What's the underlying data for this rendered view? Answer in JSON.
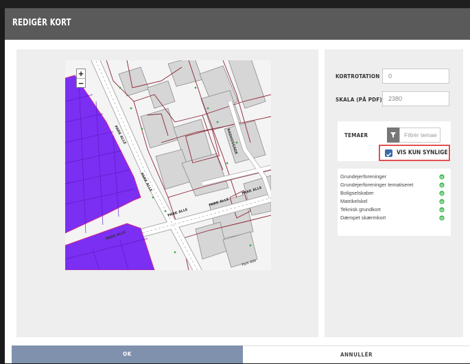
{
  "dialog": {
    "title": "REDIGÉR KORT"
  },
  "fields": {
    "kortrotation": {
      "label": "KORTROTATION",
      "value": "0"
    },
    "skala": {
      "label": "SKALA (PÅ PDF)",
      "value": "2380"
    }
  },
  "temaer": {
    "label": "TEMAER",
    "filter_placeholder": "Filtrér temae",
    "vis_kun_synlige": {
      "label": "VIS KUN SYNLIGE",
      "checked": true
    }
  },
  "layers": [
    {
      "name": "Grundejerforeninger",
      "visible": true
    },
    {
      "name": "Grundejerforeninger tematiseret",
      "visible": true
    },
    {
      "name": "Boligselskaber",
      "visible": true
    },
    {
      "name": "Matrikelskel",
      "visible": true
    },
    {
      "name": "Teknisk grundkort",
      "visible": true
    },
    {
      "name": "Dæmpet skærmkort",
      "visible": true
    }
  ],
  "map": {
    "zoom_in": "+",
    "zoom_out": "−",
    "street_labels": [
      "PARK ALLE",
      "PARK ALLE",
      "PARK ALLE",
      "PARK ALLE",
      "PARK ALLE",
      "PARK ALLE",
      "RADHUSGADE",
      "Park Allé"
    ],
    "highlight_color": "#7b2ff2"
  },
  "footer": {
    "ok": "OK",
    "cancel": "ANNULLÉR"
  },
  "colors": {
    "titlebar": "#5a5a5a",
    "ok_button": "#7f91ad",
    "highlight_border": "#e0504f",
    "checkbox": "#3c6aa8",
    "power_icon": "#2fb344"
  }
}
